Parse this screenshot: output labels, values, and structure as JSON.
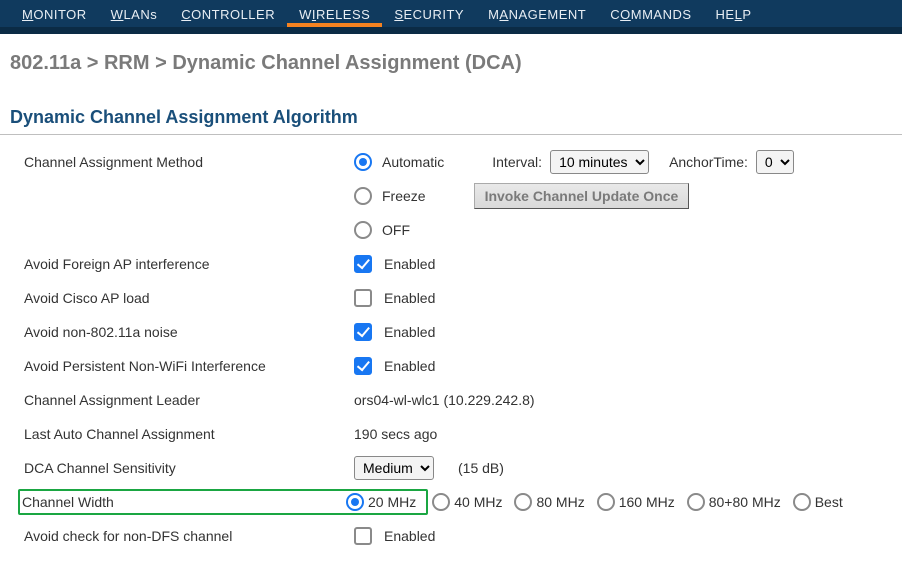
{
  "nav": {
    "items": [
      {
        "pre": "",
        "u": "M",
        "post": "ONITOR"
      },
      {
        "pre": "",
        "u": "W",
        "post": "LANs"
      },
      {
        "pre": "",
        "u": "C",
        "post": "ONTROLLER"
      },
      {
        "pre": "W",
        "u": "I",
        "post": "RELESS"
      },
      {
        "pre": "",
        "u": "S",
        "post": "ECURITY"
      },
      {
        "pre": "M",
        "u": "A",
        "post": "NAGEMENT"
      },
      {
        "pre": "C",
        "u": "O",
        "post": "MMANDS"
      },
      {
        "pre": "HE",
        "u": "L",
        "post": "P"
      }
    ],
    "active_index": 3
  },
  "breadcrumb": "802.11a > RRM > Dynamic Channel Assignment (DCA)",
  "section_title": "Dynamic Channel Assignment Algorithm",
  "labels": {
    "channel_assignment_method": "Channel Assignment Method",
    "avoid_foreign_ap": "Avoid Foreign AP interference",
    "avoid_cisco_ap": "Avoid Cisco AP load",
    "avoid_non_80211a": "Avoid non-802.11a noise",
    "avoid_persistent": "Avoid Persistent Non-WiFi Interference",
    "channel_leader": "Channel Assignment Leader",
    "last_auto": "Last Auto Channel Assignment",
    "sensitivity": "DCA Channel Sensitivity",
    "channel_width": "Channel Width",
    "avoid_ndfs": "Avoid check for non-DFS channel",
    "enabled": "Enabled",
    "interval": "Interval:",
    "anchor": "AnchorTime:"
  },
  "method": {
    "options": {
      "auto": "Automatic",
      "freeze": "Freeze",
      "off": "OFF"
    },
    "selected": "auto",
    "interval_value": "10 minutes",
    "anchor_value": "0",
    "invoke_btn": "Invoke Channel Update Once"
  },
  "checks": {
    "foreign_ap": true,
    "cisco_ap": false,
    "non_80211a": true,
    "persistent": true,
    "ndfs": false
  },
  "leader_value": "ors04-wl-wlc1 (10.229.242.8)",
  "last_auto_value": "190 secs ago",
  "sensitivity_value": "Medium",
  "sensitivity_db": "(15 dB)",
  "width": {
    "options": [
      "20 MHz",
      "40 MHz",
      "80 MHz",
      "160 MHz",
      "80+80 MHz",
      "Best"
    ],
    "selected": 0
  }
}
